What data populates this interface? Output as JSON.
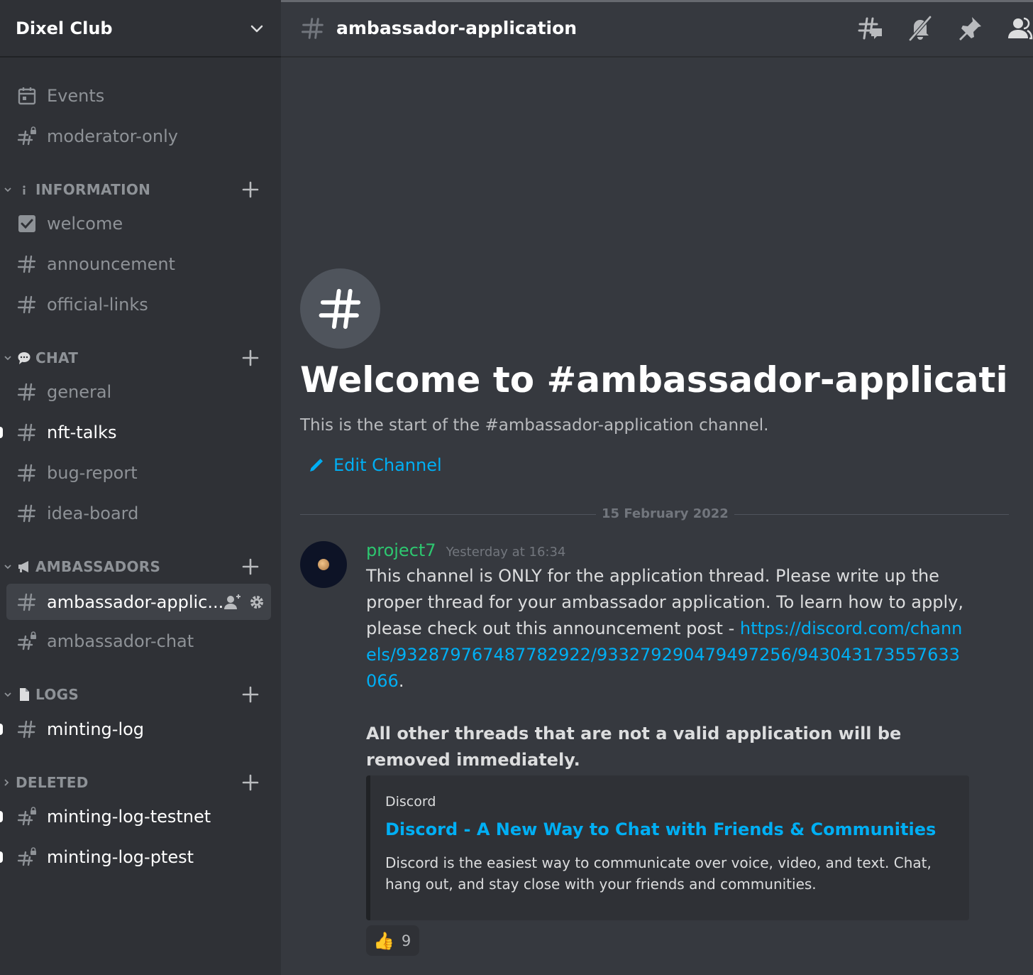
{
  "server": {
    "name": "Dixel Club"
  },
  "sidebar": {
    "top_items": [
      {
        "label": "Events",
        "icon": "calendar-icon"
      },
      {
        "label": "moderator-only",
        "icon": "locked-hash-icon"
      }
    ],
    "categories": [
      {
        "name": "INFORMATION",
        "icon": "info-icon",
        "collapsed": false,
        "channels": [
          {
            "label": "welcome",
            "icon": "checkbox-icon"
          },
          {
            "label": "announcement",
            "icon": "hash-icon"
          },
          {
            "label": "official-links",
            "icon": "hash-icon"
          }
        ]
      },
      {
        "name": "CHAT",
        "icon": "speech-bubble-icon",
        "collapsed": false,
        "channels": [
          {
            "label": "general",
            "icon": "hash-icon"
          },
          {
            "label": "nft-talks",
            "icon": "hash-icon",
            "unread": true
          },
          {
            "label": "bug-report",
            "icon": "hash-icon"
          },
          {
            "label": "idea-board",
            "icon": "hash-icon"
          }
        ]
      },
      {
        "name": "AMBASSADORS",
        "icon": "megaphone-icon",
        "collapsed": false,
        "channels": [
          {
            "label": "ambassador-applic...",
            "icon": "hash-icon",
            "selected": true
          },
          {
            "label": "ambassador-chat",
            "icon": "locked-hash-icon"
          }
        ]
      },
      {
        "name": "LOGS",
        "icon": "document-icon",
        "collapsed": false,
        "channels": [
          {
            "label": "minting-log",
            "icon": "hash-icon",
            "unread": true
          }
        ]
      },
      {
        "name": "DELETED",
        "icon": "",
        "collapsed": true,
        "channels": [
          {
            "label": "minting-log-testnet",
            "icon": "locked-hash-icon",
            "unread": true
          },
          {
            "label": "minting-log-ptest",
            "icon": "locked-hash-icon",
            "unread": true
          }
        ]
      }
    ]
  },
  "header": {
    "channel_name": "ambassador-application",
    "icons": [
      "threads-icon",
      "muted-bell-icon",
      "pin-icon",
      "members-icon"
    ]
  },
  "welcome": {
    "title": "Welcome to #ambassador-applicati...",
    "subtitle": "This is the start of the #ambassador-application channel.",
    "edit_label": "Edit Channel"
  },
  "date_divider": "15 February 2022",
  "message": {
    "author": "project7",
    "timestamp": "Yesterday at 16:34",
    "text_before_link": "This channel is ONLY for the application thread. Please write up the proper thread for your ambassador application. To learn how to apply, please check out this announcement post -",
    "link": "https://discord.com/channels/932879767487782922/933279290479497256/943043173557633066",
    "text_after_link": ".",
    "bold_text": "All other threads that are not a valid application will be removed immediately.",
    "embed": {
      "provider": "Discord",
      "title": "Discord - A New Way to Chat with Friends & Communities",
      "description": "Discord is the easiest way to communicate over voice, video, and text. Chat, hang out, and stay close with your friends and communities."
    },
    "reaction": {
      "emoji": "👍",
      "count": "9"
    }
  },
  "colors": {
    "accent": "#00aff4",
    "author": "#2dc770",
    "sidebar_bg": "#2f3136",
    "main_bg": "#36393f"
  }
}
